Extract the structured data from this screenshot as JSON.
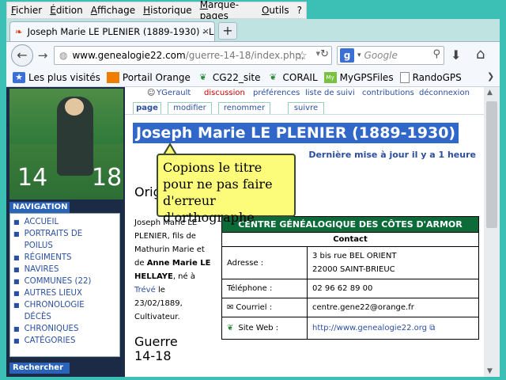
{
  "menubar": {
    "items": [
      "Fichier",
      "Édition",
      "Affichage",
      "Historique",
      "Marque-pages",
      "Outils",
      "?"
    ]
  },
  "tab": {
    "title": "Joseph Marie LE PLENIER (1889-1930) - L...",
    "close_glyph": "×",
    "new_tab_glyph": "+"
  },
  "navbar": {
    "url_host": "www.genealogie22.com",
    "url_path": "/guerre-14-18/index.php,",
    "search_placeholder": "Google",
    "search_engine_letter": "g"
  },
  "bookmarks": [
    {
      "label": "Les plus visités",
      "icon": "star-icon",
      "color": "#3a6fd8"
    },
    {
      "label": "Portail Orange",
      "icon": "orange-icon",
      "color": "#f07d00"
    },
    {
      "label": "CG22_site",
      "icon": "cg22-icon",
      "color": "#2a8a3a"
    },
    {
      "label": "CORAIL",
      "icon": "corail-icon",
      "color": "#2a8a3a"
    },
    {
      "label": "MyGPSFiles",
      "icon": "gps-icon",
      "color": "#7ac143"
    },
    {
      "label": "RandoGPS",
      "icon": "page-icon",
      "color": "#888888"
    }
  ],
  "page_tools": {
    "user": "YGerault",
    "discussion": "discussion",
    "preferences": "préférences",
    "watchlist": "liste de suivi",
    "contributions": "contributions",
    "logout": "déconnexion"
  },
  "page_tabs": [
    "page",
    "modifier",
    "renommer",
    "suivre"
  ],
  "sidebar": {
    "logo_left": "14",
    "logo_right": "18",
    "nav_heading": "NAVIGATION",
    "items": [
      {
        "label": "ACCUEIL"
      },
      {
        "label": "PORTRAITS DE POILUS"
      },
      {
        "label": "RÉGIMENTS"
      },
      {
        "label": "NAVIRES"
      },
      {
        "label": "COMMUNES (22)"
      },
      {
        "label": "AUTRES LIEUX"
      },
      {
        "label": "CHRONOLOGIE DÉCÈS"
      },
      {
        "label": "CHRONIQUES"
      },
      {
        "label": "CATÉGORIES"
      }
    ],
    "search_heading": "Rechercher"
  },
  "article": {
    "title": "Joseph Marie LE PLENIER (1889-1930)",
    "updated": "Dernière mise à jour il y a 1 heure",
    "section_origin": "Orig",
    "bio_line1": "Joseph Marie LE PLENIER, fils de Mathurin Marie et de",
    "bio_mother": "Anne Marie LE HELLAYE",
    "bio_born": ", né à",
    "bio_place": "Trévé",
    "bio_date": " le 23/02/1889, Cultivateur.",
    "section_war": "Guerre 14-18"
  },
  "contact_table": {
    "heading": "CENTRE GÉNÉALOGIQUE DES CÔTES D'ARMOR",
    "subheading": "Contact",
    "rows": [
      {
        "label": "Adresse :",
        "value_line1": "3 bis rue BEL ORIENT",
        "value_line2": "22000 SAINT-BRIEUC"
      },
      {
        "label": "Téléphone :",
        "value_line1": "02 96 62 89 00",
        "value_line2": ""
      },
      {
        "label": "Courriel :",
        "value_line1": "centre.gene22@orange.fr",
        "value_line2": ""
      },
      {
        "label": "Site Web :",
        "value_line1": "http://www.genealogie22.org",
        "value_line2": ""
      }
    ]
  },
  "tooltip": {
    "text": "Copions le titre pour ne pas faire d'erreur d'orthographe"
  }
}
